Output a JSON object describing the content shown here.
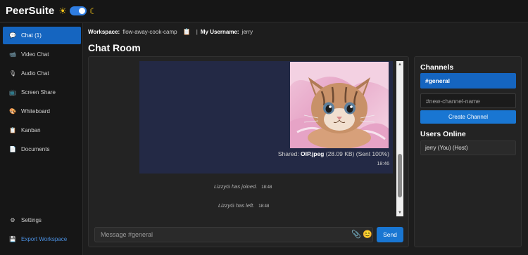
{
  "app": {
    "title": "PeerSuite",
    "theme": {
      "sun_glyph": "☀",
      "moon_glyph": "☾",
      "dark_mode": true
    }
  },
  "sidebar": {
    "items": [
      {
        "label": "Chat (1)",
        "icon": "chat-icon",
        "glyph": "💬",
        "active": true
      },
      {
        "label": "Video Chat",
        "icon": "video-camera-icon",
        "glyph": "📹"
      },
      {
        "label": "Audio Chat",
        "icon": "microphone-icon",
        "glyph": "🎙"
      },
      {
        "label": "Screen Share",
        "icon": "monitor-icon",
        "glyph": "📺"
      },
      {
        "label": "Whiteboard",
        "icon": "palette-icon",
        "glyph": "🎨"
      },
      {
        "label": "Kanban",
        "icon": "clipboard-icon",
        "glyph": "📋"
      },
      {
        "label": "Documents",
        "icon": "document-icon",
        "glyph": "📄"
      }
    ],
    "settings": {
      "label": "Settings",
      "icon": "gear-icon",
      "glyph": "⚙"
    },
    "export": {
      "label": "Export Workspace",
      "icon": "floppy-disk-icon",
      "glyph": "💾"
    }
  },
  "header": {
    "workspace_label": "Workspace:",
    "workspace_name": "flow-away-cook-camp",
    "copy_glyph": "📋",
    "separator": "|",
    "username_label": "My Username:",
    "username": "jerry"
  },
  "page_title": "Chat Room",
  "chat": {
    "messages": [
      {
        "type": "file",
        "image_icon": "kitten-photo",
        "shared_prefix": "Shared:",
        "filename": "OIP.jpeg",
        "details": "(28.09 KB) (Sent 100%)",
        "time": "18:46"
      }
    ],
    "system": [
      {
        "text": "LizzyG has joined.",
        "time": "18:48"
      },
      {
        "text": "LizzyG has left.",
        "time": "18:48"
      }
    ],
    "scroll_up_glyph": "▲",
    "scroll_down_glyph": "▼",
    "input_placeholder": "Message #general",
    "attach_glyph": "📎",
    "emoji_glyph": "😊",
    "send_label": "Send"
  },
  "channels": {
    "title": "Channels",
    "items": [
      {
        "label": "#general",
        "active": true
      }
    ],
    "new_channel_placeholder": "#new-channel-name",
    "create_label": "Create Channel"
  },
  "users_online": {
    "title": "Users Online",
    "items": [
      {
        "label": "jerry (You) (Host)"
      }
    ]
  },
  "colors": {
    "accent": "#1976d2",
    "active_nav": "#1565c0",
    "message_bubble": "#232945",
    "background": "#1d1d1d"
  }
}
